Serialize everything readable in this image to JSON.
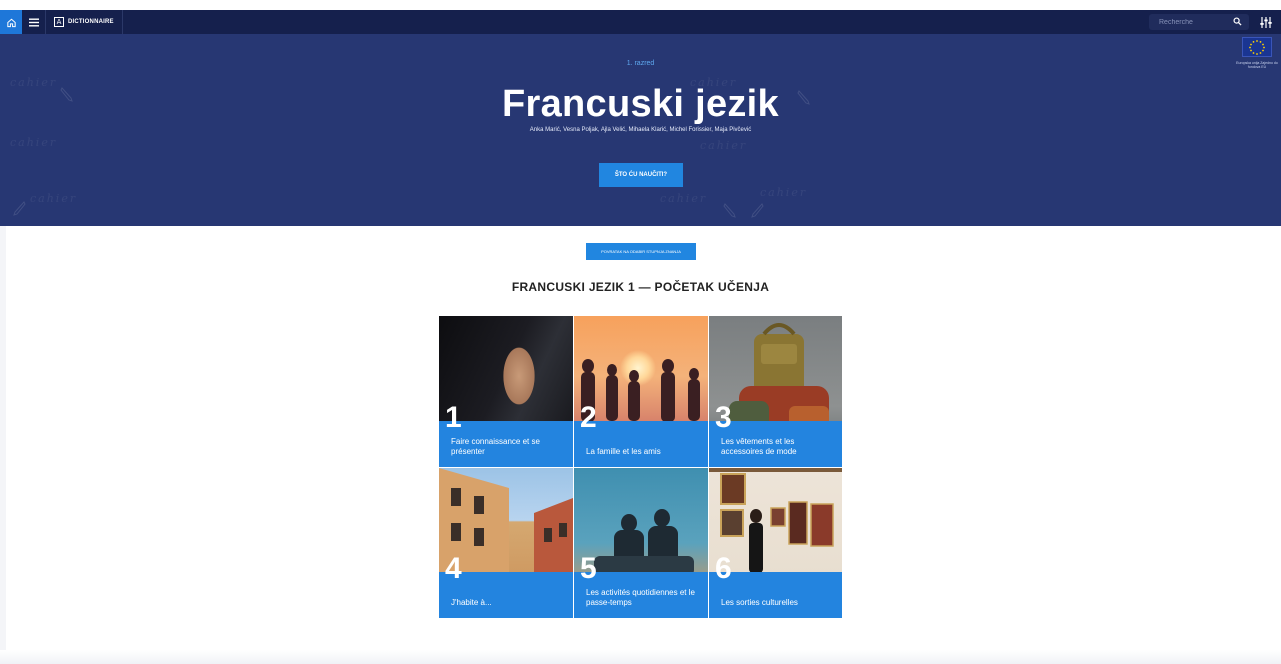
{
  "nav": {
    "dictionary_label": "DICTIONNAIRE",
    "dictionary_icon_glyph": "A",
    "search_placeholder": "Recherche",
    "icons": [
      "home-icon",
      "menu-icon",
      "dictionary-icon",
      "search-icon",
      "settings-icon"
    ]
  },
  "hero": {
    "grade": "1. razred",
    "title": "Francuski jezik",
    "authors": "Anka Marić, Vesna Poljak, Ajla Velić, Mihaela Klarić, Michel Forissier, Maja Pivčević",
    "cta_label": "ŠTO ĆU NAUČITI?",
    "eu_caption": "Europska unija Zajedno do fondova EU",
    "decor_word": "cahier"
  },
  "main": {
    "back_label": "POVRATAK NA ODABIR STUPNJA ZNANJA",
    "section_title": "FRANCUSKI JEZIK 1 — POČETAK UČENJA",
    "units": [
      {
        "number": "1",
        "title": "Faire connaissance et se présenter"
      },
      {
        "number": "2",
        "title": "La famille et les amis"
      },
      {
        "number": "3",
        "title": "Les vêtements et les accessoires de mode"
      },
      {
        "number": "4",
        "title": "J'habite à..."
      },
      {
        "number": "5",
        "title": "Les activités quotidiennes et le passe-temps"
      },
      {
        "number": "6",
        "title": "Les sorties culturelles"
      }
    ]
  },
  "colors": {
    "nav_bg": "#15204d",
    "hero_bg": "#273773",
    "accent_blue": "#2186e0",
    "tile_band": "#2384df"
  }
}
